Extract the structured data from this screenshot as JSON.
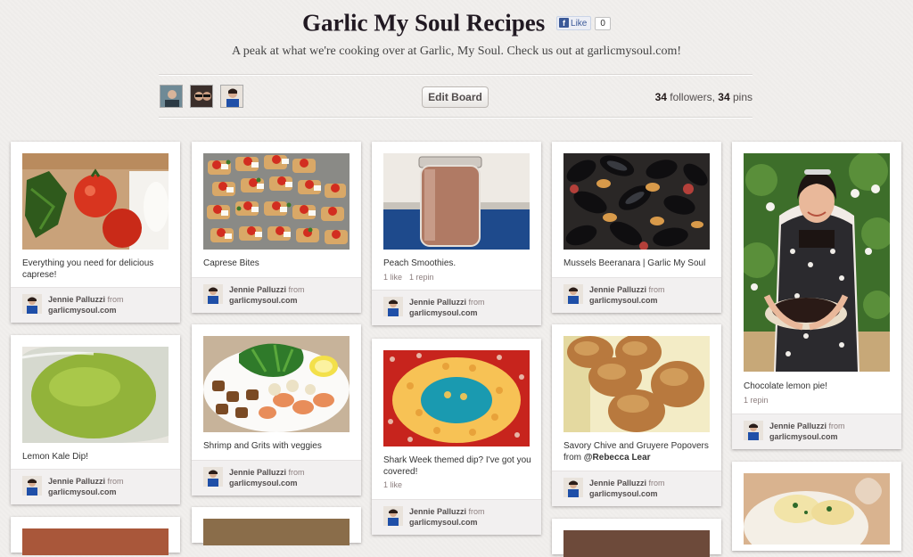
{
  "board": {
    "title": "Garlic My Soul Recipes",
    "description": "A peak at what we're cooking over at Garlic, My Soul. Check us out at garlicmysoul.com!",
    "like_label": "Like",
    "like_count": "0",
    "edit_label": "Edit Board",
    "followers": "34",
    "followers_label": " followers, ",
    "pins": "34",
    "pins_label": " pins"
  },
  "pinner": {
    "name": "Jennie Palluzzi",
    "from_label": "from",
    "source": "garlicmysoul.com"
  },
  "pins": [
    {
      "caption": "Everything you need for delicious caprese!",
      "likes": "",
      "repins": ""
    },
    {
      "caption": "Caprese Bites",
      "likes": "",
      "repins": ""
    },
    {
      "caption": "Peach Smoothies.",
      "likes": "1 like",
      "repins": "1 repin"
    },
    {
      "caption": "Mussels Beeranara | Garlic My Soul",
      "likes": "",
      "repins": ""
    },
    {
      "caption": "Chocolate lemon pie!",
      "likes": "1 repin",
      "repins": ""
    },
    {
      "caption": "Lemon Kale Dip!",
      "likes": "",
      "repins": ""
    },
    {
      "caption": "Shrimp and Grits with veggies",
      "likes": "",
      "repins": ""
    },
    {
      "caption": "Shark Week themed dip? I've got you covered!",
      "likes": "1 like",
      "repins": ""
    },
    {
      "caption": "Savory Chive and Gruyere Popovers from ",
      "mention": "@Rebecca Lear",
      "likes": "",
      "repins": ""
    }
  ],
  "colors": {
    "background": "#f1efed",
    "card": "#ffffff",
    "attribution_bg": "#f2f0f0",
    "facebook_blue": "#3b5998"
  }
}
